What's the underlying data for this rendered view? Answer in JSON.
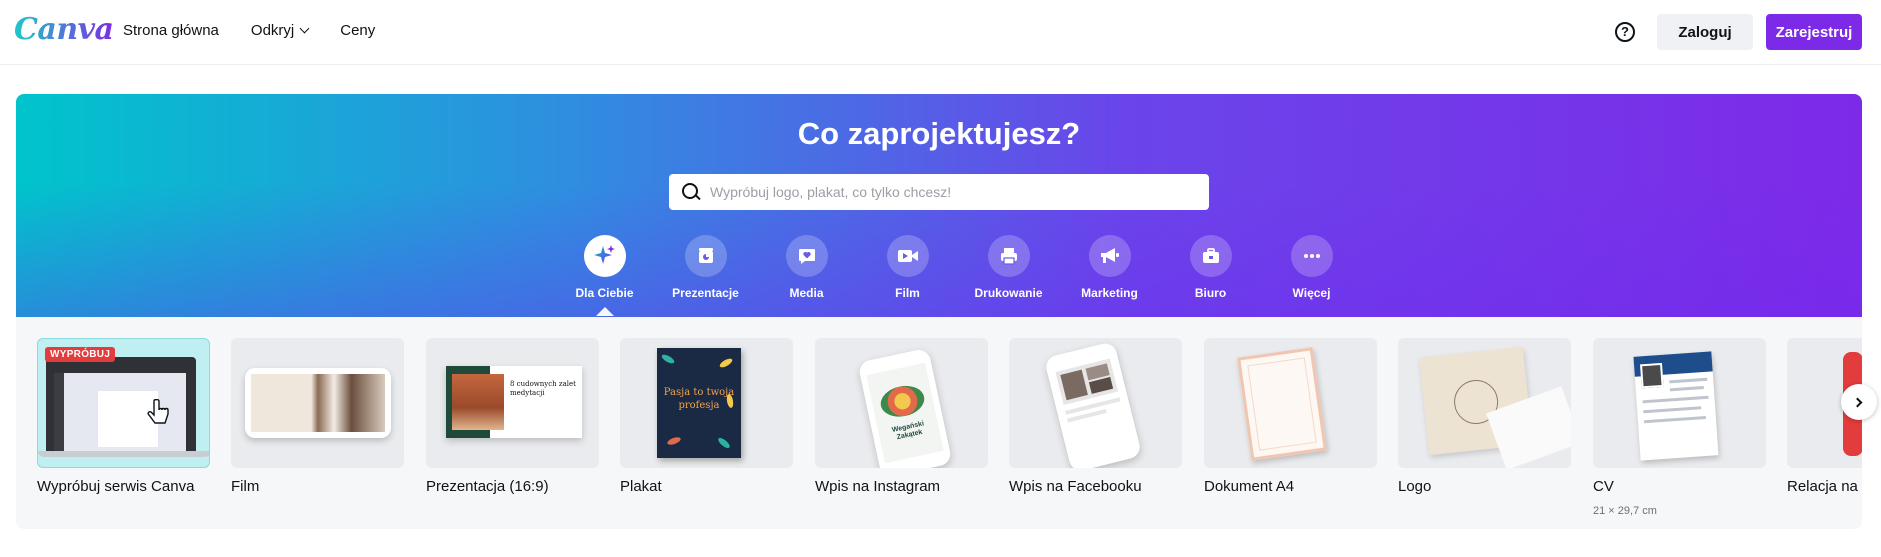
{
  "header": {
    "logo": "Canva",
    "nav": [
      {
        "label": "Strona główna",
        "has_dropdown": false
      },
      {
        "label": "Odkryj",
        "has_dropdown": true
      },
      {
        "label": "Ceny",
        "has_dropdown": false
      }
    ],
    "help_icon": "?",
    "login_label": "Zaloguj",
    "signup_label": "Zarejestruj"
  },
  "hero": {
    "title": "Co zaprojektujesz?",
    "search_placeholder": "Wypróbuj logo, plakat, co tylko chcesz!",
    "categories": [
      {
        "label": "Dla Ciebie",
        "icon": "sparkle-icon",
        "active": true
      },
      {
        "label": "Prezentacje",
        "icon": "presentation-icon",
        "active": false
      },
      {
        "label": "Media",
        "icon": "heart-chat-icon",
        "active": false
      },
      {
        "label": "Film",
        "icon": "video-camera-icon",
        "active": false
      },
      {
        "label": "Drukowanie",
        "icon": "printer-icon",
        "active": false
      },
      {
        "label": "Marketing",
        "icon": "megaphone-icon",
        "active": false
      },
      {
        "label": "Biuro",
        "icon": "briefcase-icon",
        "active": false
      },
      {
        "label": "Więcej",
        "icon": "more-dots-icon",
        "active": false
      }
    ]
  },
  "templates": [
    {
      "title": "Wypróbuj serwis Canva",
      "badge": "WYPRÓBUJ",
      "subtitle": ""
    },
    {
      "title": "Film",
      "subtitle": ""
    },
    {
      "title": "Prezentacja (16:9)",
      "subtitle": "",
      "thumb_text": "8 cudownych zalet medytacji"
    },
    {
      "title": "Plakat",
      "subtitle": "",
      "thumb_text": "Pasja to twoja profesja"
    },
    {
      "title": "Wpis na Instagram",
      "subtitle": "",
      "thumb_text": "Wegański Zakątek"
    },
    {
      "title": "Wpis na Facebooku",
      "subtitle": ""
    },
    {
      "title": "Dokument A4",
      "subtitle": ""
    },
    {
      "title": "Logo",
      "subtitle": ""
    },
    {
      "title": "CV",
      "subtitle": "21 × 29,7 cm"
    },
    {
      "title": "Relacja na In",
      "subtitle": ""
    }
  ],
  "colors": {
    "brand_purple": "#7d2ae8",
    "brand_teal": "#00c4cc",
    "badge_red": "#e23c3c"
  }
}
